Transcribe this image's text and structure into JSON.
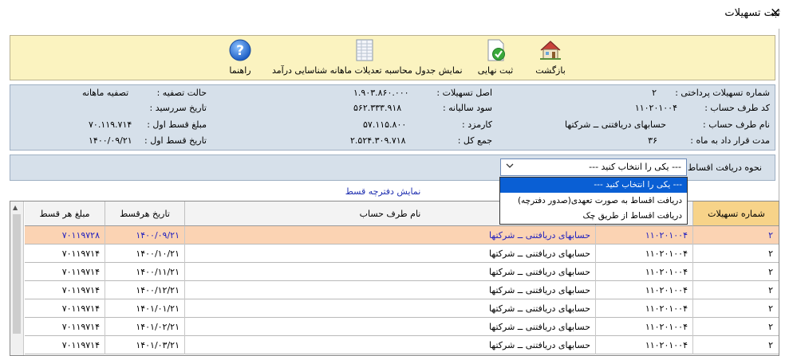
{
  "window": {
    "title": "ثبت تسهیلات",
    "close_icon": "×"
  },
  "toolbar": {
    "back_label": "بازگشت",
    "final_save_label": "ثبت نهایی",
    "show_table_label": "نمایش جدول محاسبه تعدیلات ماهانه شناسایی درآمد",
    "help_label": "راهنما"
  },
  "info": {
    "col1": {
      "r1_label": "شماره تسهیلات پرداختی :",
      "r1_value": "۲",
      "r2_label": "کد طرف حساب :",
      "r2_value": "۱۱۰۲۰۱۰۰۴",
      "r3_label": "نام طرف حساب :",
      "r3_value": "حسابهای دریافتنی ــ شرکتها",
      "r4_label": "مدت قرار داد به ماه :",
      "r4_value": "۳۶"
    },
    "col2": {
      "r1_label": "اصل تسهیلات :",
      "r1_value": "۱.۹۰۳.۸۶۰.۰۰۰",
      "r2_label": "سود سالیانه :",
      "r2_value": "۵۶۲.۳۳۳.۹۱۸",
      "r3_label": "کارمزد :",
      "r3_value": "۵۷.۱۱۵.۸۰۰",
      "r4_label": "جمع کل :",
      "r4_value": "۲.۵۲۴.۳۰۹.۷۱۸"
    },
    "col3": {
      "r1_label": "حالت تصفیه :",
      "r1_value": "تصفیه ماهانه",
      "r2_label": "تاریخ سررسید :",
      "r2_value": "",
      "r3_label": "مبلغ قسط اول :",
      "r3_value": "۷۰.۱۱۹.۷۱۴",
      "r4_label": "تاریخ قسط اول :",
      "r4_value": "۱۴۰۰/۰۹/۲۱"
    }
  },
  "payment": {
    "label": "نحوه دریافت اقساط :",
    "selected": "--- یکی را انتخاب کنید ---",
    "options": [
      "--- یکی را انتخاب کنید ---",
      "دریافت اقساط به صورت تعهدی(صدور دفترچه)",
      "دریافت اقساط از طریق چک"
    ]
  },
  "booklet_link": "نمایش دفترچه قسط",
  "grid": {
    "headers": {
      "facility_no": "شماره تسهیلات",
      "account_code": "",
      "account_name": "نام طرف حساب",
      "due_date": "تاریخ هرقسط",
      "amount": "مبلغ هر قسط"
    },
    "rows": [
      {
        "facility_no": "۲",
        "account_code": "۱۱۰۲۰۱۰۰۴",
        "account_name": "حسابهای دریافتنی ــ شرکتها",
        "due_date": "۱۴۰۰/۰۹/۲۱",
        "amount": "۷۰۱۱۹۷۲۸"
      },
      {
        "facility_no": "۲",
        "account_code": "۱۱۰۲۰۱۰۰۴",
        "account_name": "حسابهای دریافتنی ــ شرکتها",
        "due_date": "۱۴۰۰/۱۰/۲۱",
        "amount": "۷۰۱۱۹۷۱۴"
      },
      {
        "facility_no": "۲",
        "account_code": "۱۱۰۲۰۱۰۰۴",
        "account_name": "حسابهای دریافتنی ــ شرکتها",
        "due_date": "۱۴۰۰/۱۱/۲۱",
        "amount": "۷۰۱۱۹۷۱۴"
      },
      {
        "facility_no": "۲",
        "account_code": "۱۱۰۲۰۱۰۰۴",
        "account_name": "حسابهای دریافتنی ــ شرکتها",
        "due_date": "۱۴۰۰/۱۲/۲۱",
        "amount": "۷۰۱۱۹۷۱۴"
      },
      {
        "facility_no": "۲",
        "account_code": "۱۱۰۲۰۱۰۰۴",
        "account_name": "حسابهای دریافتنی ــ شرکتها",
        "due_date": "۱۴۰۱/۰۱/۲۱",
        "amount": "۷۰۱۱۹۷۱۴"
      },
      {
        "facility_no": "۲",
        "account_code": "۱۱۰۲۰۱۰۰۴",
        "account_name": "حسابهای دریافتنی ــ شرکتها",
        "due_date": "۱۴۰۱/۰۲/۲۱",
        "amount": "۷۰۱۱۹۷۱۴"
      },
      {
        "facility_no": "۲",
        "account_code": "۱۱۰۲۰۱۰۰۴",
        "account_name": "حسابهای دریافتنی ــ شرکتها",
        "due_date": "۱۴۰۱/۰۳/۲۱",
        "amount": "۷۰۱۱۹۷۱۴"
      }
    ]
  },
  "colors": {
    "toolbar_bg": "#fbf3c0",
    "panel_bg": "#d6e0ea",
    "selected_row": "#fbd3b3",
    "active_header": "#f7d389",
    "link": "#1f2fb0"
  }
}
